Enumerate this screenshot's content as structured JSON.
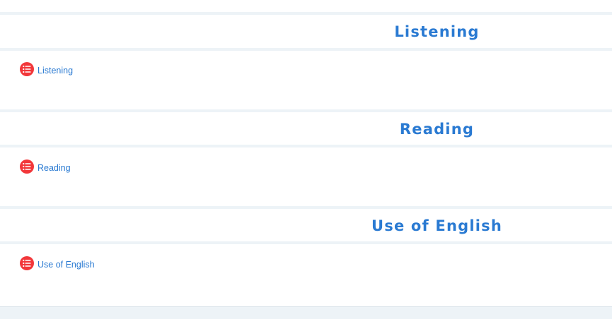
{
  "sections": [
    {
      "title": "Listening",
      "activity": {
        "label": "Listening",
        "icon": "checklist-icon"
      }
    },
    {
      "title": "Reading",
      "activity": {
        "label": "Reading",
        "icon": "checklist-icon"
      }
    },
    {
      "title": "Use of English",
      "activity": {
        "label": "Use of English",
        "icon": "checklist-icon"
      }
    }
  ],
  "colors": {
    "accent": "#2a7ad2",
    "icon_bg": "#f2373a",
    "divider": "#edf3f7"
  }
}
